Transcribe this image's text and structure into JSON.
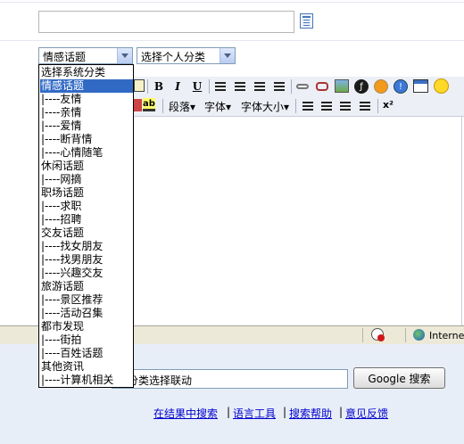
{
  "form": {
    "title_input_value": "",
    "system_category_selected": "情感话题",
    "personal_category_selected": "选择个人分类"
  },
  "toolbar": {
    "bold_label": "B",
    "italic_label": "I",
    "underline_label": "U",
    "paragraph_label": "段落▾",
    "font_label": "字体▾",
    "font_size_label": "字体大小▾",
    "superscript_label": "x²",
    "highlight_label": "ab"
  },
  "dropdown": {
    "options": [
      {
        "label": "选择系统分类",
        "selected": false
      },
      {
        "label": "情感话题",
        "selected": true
      },
      {
        "label": "|----友情",
        "selected": false
      },
      {
        "label": "|----亲情",
        "selected": false
      },
      {
        "label": "|----爱情",
        "selected": false
      },
      {
        "label": "|----断背情",
        "selected": false
      },
      {
        "label": "|----心情随笔",
        "selected": false
      },
      {
        "label": "休闲话题",
        "selected": false
      },
      {
        "label": "|----网摘",
        "selected": false
      },
      {
        "label": "职场话题",
        "selected": false
      },
      {
        "label": "|----求职",
        "selected": false
      },
      {
        "label": "|----招聘",
        "selected": false
      },
      {
        "label": "交友话题",
        "selected": false
      },
      {
        "label": "|----找女朋友",
        "selected": false
      },
      {
        "label": "|----找男朋友",
        "selected": false
      },
      {
        "label": "|----兴趣交友",
        "selected": false
      },
      {
        "label": "旅游话题",
        "selected": false
      },
      {
        "label": "|----景区推荐",
        "selected": false
      },
      {
        "label": "|----活动召集",
        "selected": false
      },
      {
        "label": "都市发现",
        "selected": false
      },
      {
        "label": "|----街拍",
        "selected": false
      },
      {
        "label": "|----百姓话题",
        "selected": false
      },
      {
        "label": "其他资讯",
        "selected": false
      },
      {
        "label": "|----计算机相关",
        "selected": false
      }
    ]
  },
  "statusbar": {
    "zone_label": "Internet"
  },
  "google": {
    "search_value": "og分类选择联动",
    "button_label": "Google 搜索",
    "links": [
      "在结果中搜索",
      "语言工具",
      "搜索帮助",
      "意见反馈"
    ],
    "separator": "|"
  }
}
